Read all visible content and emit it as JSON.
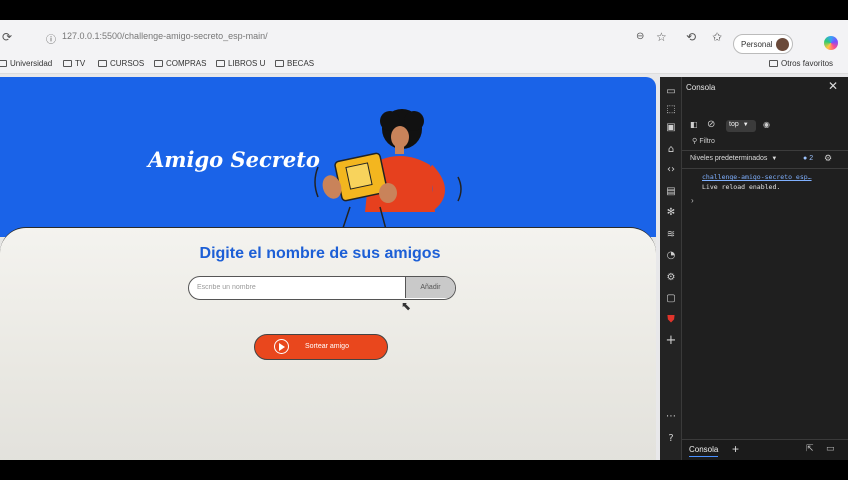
{
  "browser": {
    "url": "127.0.0.1:5500/challenge-amigo-secreto_esp-main/",
    "profile_label": "Personal",
    "bookmarks": [
      "Universidad",
      "TV",
      "CURSOS",
      "COMPRAS",
      "LIBROS U",
      "BECAS"
    ],
    "other_favorites": "Otros favoritos"
  },
  "page": {
    "hero_title": "Amigo Secreto",
    "section_title": "Digite el nombre de sus amigos",
    "name_placeholder": "Escribe un nombre",
    "add_button": "Añadir",
    "draw_button": "Sortear amigo"
  },
  "devtools": {
    "title": "Consola",
    "context": "top",
    "filter_placeholder": "Filtro",
    "levels_label": "Niveles predeterminados",
    "issues_count": "2",
    "log": {
      "source": "challenge-amigo-secreto_esp…",
      "message": "Live reload enabled."
    },
    "bottom_tab": "Consola"
  },
  "colors": {
    "hero_blue": "#1a63e8",
    "title_blue": "#1d5fd6",
    "draw_orange": "#e9471d"
  }
}
